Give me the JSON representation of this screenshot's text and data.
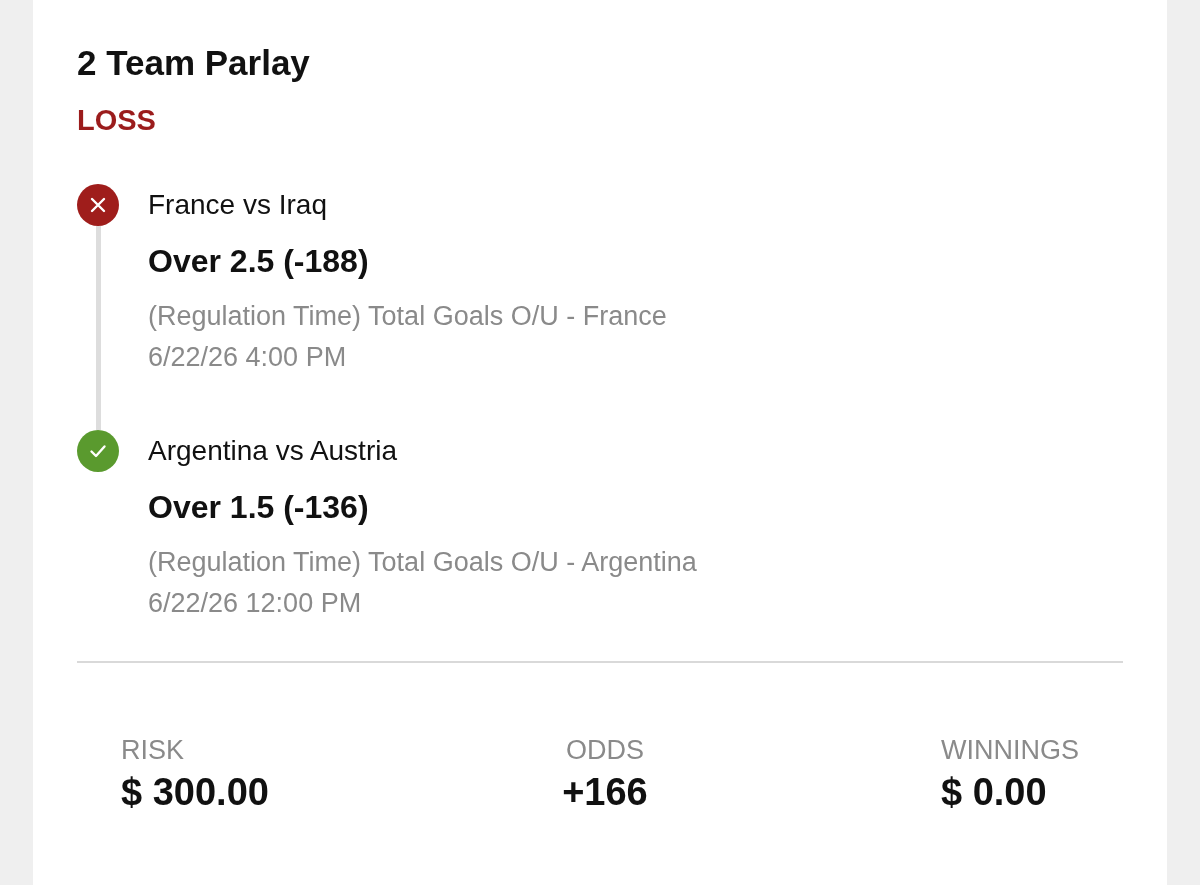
{
  "bet": {
    "title": "2 Team Parlay",
    "status": {
      "text": "LOSS",
      "kind": "loss"
    }
  },
  "legs": [
    {
      "kind": "lost",
      "matchup": "France vs Iraq",
      "pick": "Over 2.5 (-188)",
      "market": "(Regulation Time) Total Goals O/U - France",
      "start_time": "6/22/26 4:00 PM"
    },
    {
      "kind": "won",
      "matchup": "Argentina vs Austria",
      "pick": "Over 1.5 (-136)",
      "market": "(Regulation Time) Total Goals O/U - Argentina",
      "start_time": "6/22/26 12:00 PM"
    }
  ],
  "summary": [
    {
      "label": "RISK",
      "value": "$ 300.00"
    },
    {
      "label": "ODDS",
      "value": "+166"
    },
    {
      "label": "WINNINGS",
      "value": "$ 0.00"
    }
  ]
}
